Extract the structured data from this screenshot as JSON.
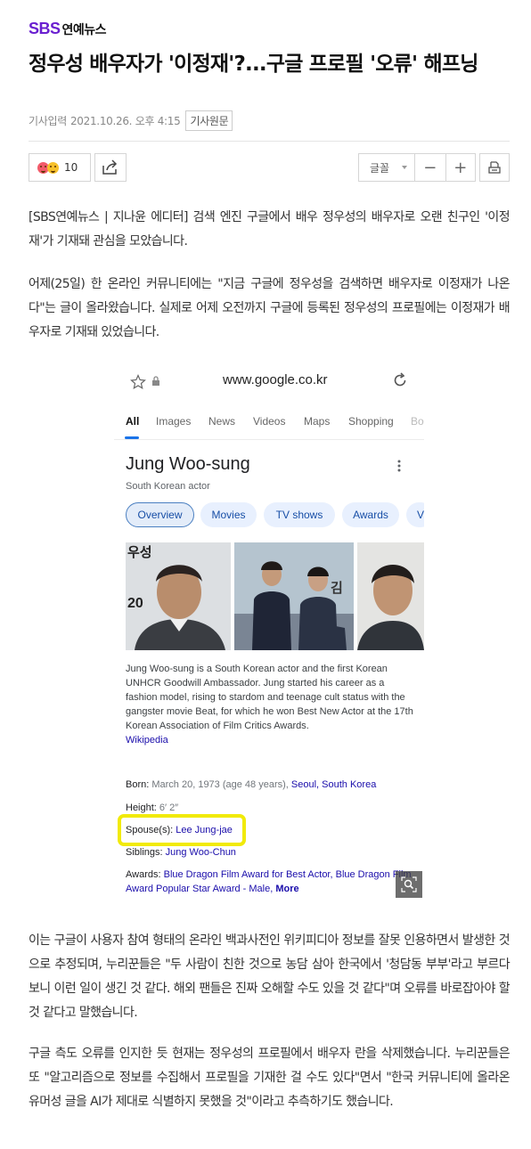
{
  "brand": {
    "logo_sbs": "SBS",
    "logo_section": "연예뉴스"
  },
  "article": {
    "headline": "정우성 배우자가 '이정재'?...구글 프로필 '오류' 해프닝",
    "meta_label": "기사입력",
    "meta_date": "2021.10.26. 오후 4:15",
    "original_button": "기사원문",
    "paragraphs": [
      "[SBS연예뉴스 | 지나윤 에디터] 검색 엔진 구글에서 배우 정우성의 배우자로 오랜 친구인 '이정재'가 기재돼 관심을 모았습니다.",
      "어제(25일) 한 온라인 커뮤니티에는 \"지금 구글에 정우성을 검색하면 배우자로 이정재가 나온다\"는 글이 올라왔습니다. 실제로 어제 오전까지 구글에 등록된 정우성의 프로필에는 이정재가 배우자로 기재돼 있었습니다.",
      "이는 구글이 사용자 참여 형태의 온라인 백과사전인 위키피디아 정보를 잘못 인용하면서 발생한 것으로 추정되며, 누리꾼들은 \"두 사람이 친한 것으로 농담 삼아 한국에서 '청담동 부부'라고 부르다 보니 이런 일이 생긴 것 같다. 해외 팬들은 진짜 오해할 수도 있을 것 같다\"며 오류를 바로잡아야 할 것 같다고 말했습니다.",
      "구글 측도 오류를 인지한 듯 현재는 정우성의 프로필에서 배우자 란을 삭제했습니다. 누리꾼들은 또 \"알고리즘으로 정보를 수집해서 프로필을 기재한 걸 수도 있다\"면서 \"한국 커뮤니티에 올라온 유머성 글을 AI가 제대로 식별하지 못했을 것\"이라고 추측하기도 했습니다."
    ]
  },
  "toolbar": {
    "reaction_count": "10",
    "font_label": "글꼴",
    "decrease_label": "−",
    "increase_label": "+",
    "share_icon": "share-icon",
    "print_icon": "print-icon"
  },
  "google": {
    "url": "www.google.co.kr",
    "tabs": [
      "All",
      "Images",
      "News",
      "Videos",
      "Maps",
      "Shopping",
      "Bo"
    ],
    "name": "Jung Woo-sung",
    "description": "South Korean actor",
    "chips": [
      "Overview",
      "Movies",
      "TV shows",
      "Awards",
      "V"
    ],
    "photo_text_1": "우성",
    "photo_text_2": "20",
    "photo_text_3": "김",
    "bio": "Jung Woo-sung is a South Korean actor and the first Korean UNHCR Goodwill Ambassador. Jung started his career as a fashion model, rising to stardom and teenage cult status with the gangster movie Beat, for which he won Best New Actor at the 17th Korean Association of Film Critics Awards.",
    "bio_source": "Wikipedia",
    "born_label": "Born:",
    "born_value": "March 20, 1973 (age 48 years),",
    "born_place": "Seoul, South Korea",
    "height_label": "Height:",
    "height_value": "6′ 2″",
    "spouse_label": "Spouse(s):",
    "spouse_value": "Lee Jung-jae",
    "siblings_label": "Siblings:",
    "siblings_value": "Jung Woo-Chun",
    "awards_label": "Awards:",
    "awards_value": "Blue Dragon Film Award for Best Actor, Blue Dragon Film Award Popular Star Award - Male,",
    "awards_more": "More",
    "highlight_color": "#f1ea08",
    "link_color": "#1a0dab"
  }
}
